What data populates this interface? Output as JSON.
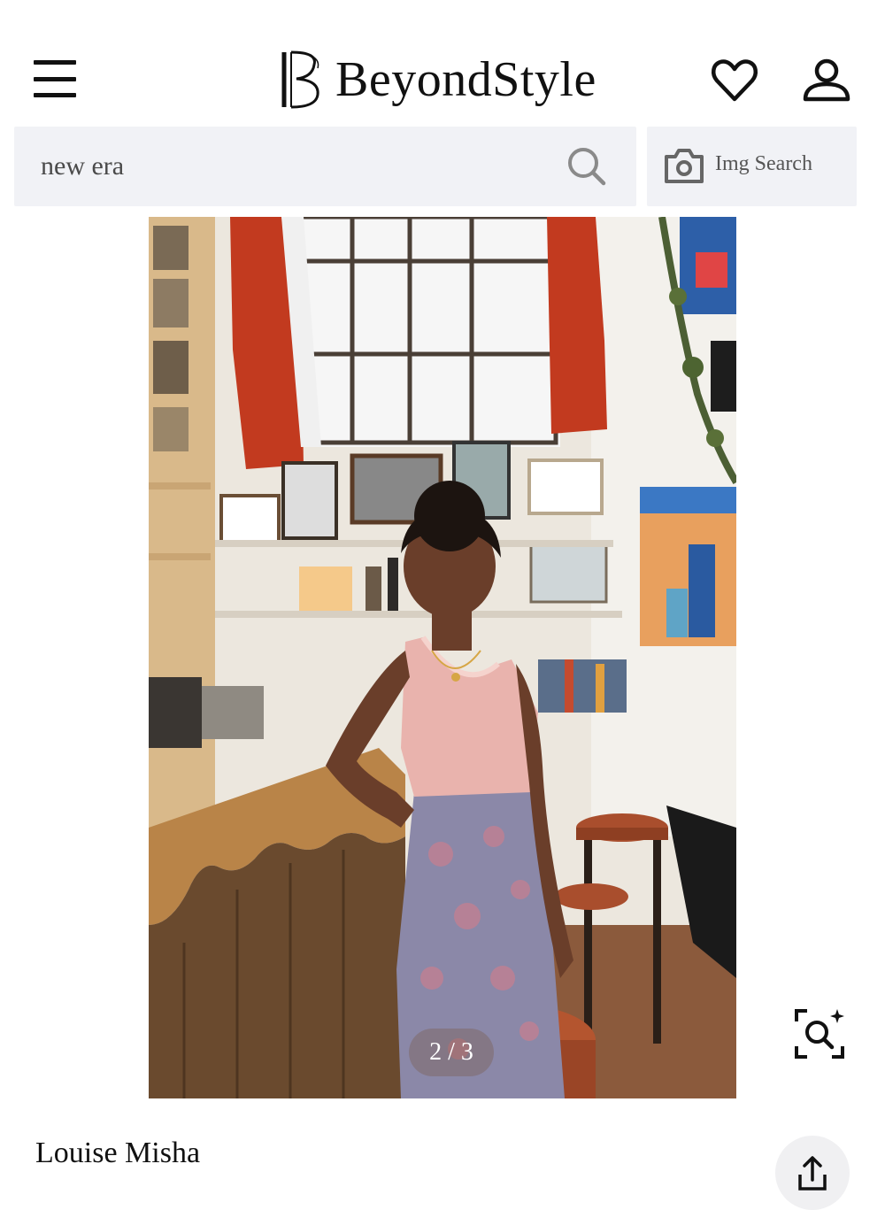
{
  "header": {
    "brand_name": "BeyondStyle",
    "icons": [
      "menu-icon",
      "heart-icon",
      "user-icon"
    ]
  },
  "search": {
    "value": "new era",
    "img_search_label": "Img Search"
  },
  "gallery": {
    "pager": "2 / 3"
  },
  "product": {
    "name": "Louise Misha"
  },
  "colors": {
    "search_bg": "#f1f2f6",
    "text": "#111111"
  }
}
